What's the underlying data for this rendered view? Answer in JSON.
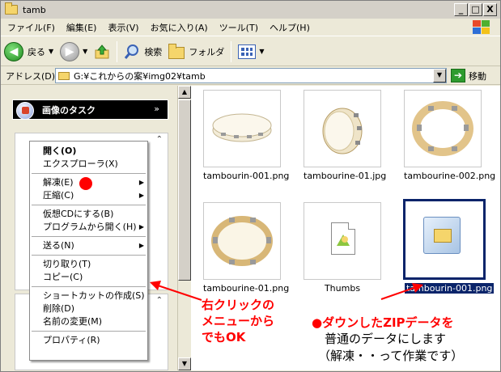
{
  "window": {
    "title": "tamb",
    "min": "_",
    "max": "□",
    "close": "X"
  },
  "menubar": [
    {
      "label": "ファイル(F)",
      "key": "file"
    },
    {
      "label": "編集(E)",
      "key": "edit"
    },
    {
      "label": "表示(V)",
      "key": "view"
    },
    {
      "label": "お気に入り(A)",
      "key": "favorites"
    },
    {
      "label": "ツール(T)",
      "key": "tools"
    },
    {
      "label": "ヘルプ(H)",
      "key": "help"
    }
  ],
  "toolbar": {
    "back": "戻る",
    "search": "検索",
    "folders": "フォルダ"
  },
  "address": {
    "label": "アドレス(D)",
    "value": "G:¥これからの案¥img02¥tamb",
    "go": "移動"
  },
  "taskpane": {
    "title": "画像のタスク"
  },
  "context_menu": [
    {
      "label": "開く(O)",
      "bold": true
    },
    {
      "label": "エクスプローラ(X)"
    },
    {
      "sep": true
    },
    {
      "label": "解凍(E)",
      "submenu": true
    },
    {
      "label": "圧縮(C)",
      "submenu": true
    },
    {
      "sep": true
    },
    {
      "label": "仮想CDにする(B)"
    },
    {
      "label": "プログラムから開く(H)",
      "submenu": true
    },
    {
      "sep": true
    },
    {
      "label": "送る(N)",
      "submenu": true
    },
    {
      "sep": true
    },
    {
      "label": "切り取り(T)"
    },
    {
      "label": "コピー(C)"
    },
    {
      "sep": true
    },
    {
      "label": "ショートカットの作成(S)"
    },
    {
      "label": "削除(D)"
    },
    {
      "label": "名前の変更(M)"
    },
    {
      "sep": true
    },
    {
      "label": "プロパティ(R)"
    }
  ],
  "files": [
    {
      "name": "tambourin-001.png",
      "kind": "tambourine-closed"
    },
    {
      "name": "tambourine-01.jpg",
      "kind": "tambourine-side"
    },
    {
      "name": "tambourine-002.png",
      "kind": "tambourine-ring"
    },
    {
      "name": "tambourine-01.png",
      "kind": "tambourine-ring2"
    },
    {
      "name": "Thumbs",
      "kind": "thumbs-db"
    },
    {
      "name": "tambourin-001.png",
      "kind": "zip",
      "selected": true
    }
  ],
  "annotations": {
    "right_click": [
      "右クリックの",
      "メニューから",
      "でもOK"
    ],
    "zip_note_1": "●ダウンしたZIPデータを",
    "zip_note_2": "普通のデータにします",
    "zip_note_3": "（解凍・・って作業です）"
  },
  "colors": {
    "selection": "#0a246a",
    "annotation": "#ff0000",
    "task_blue": "#6f80d6"
  }
}
